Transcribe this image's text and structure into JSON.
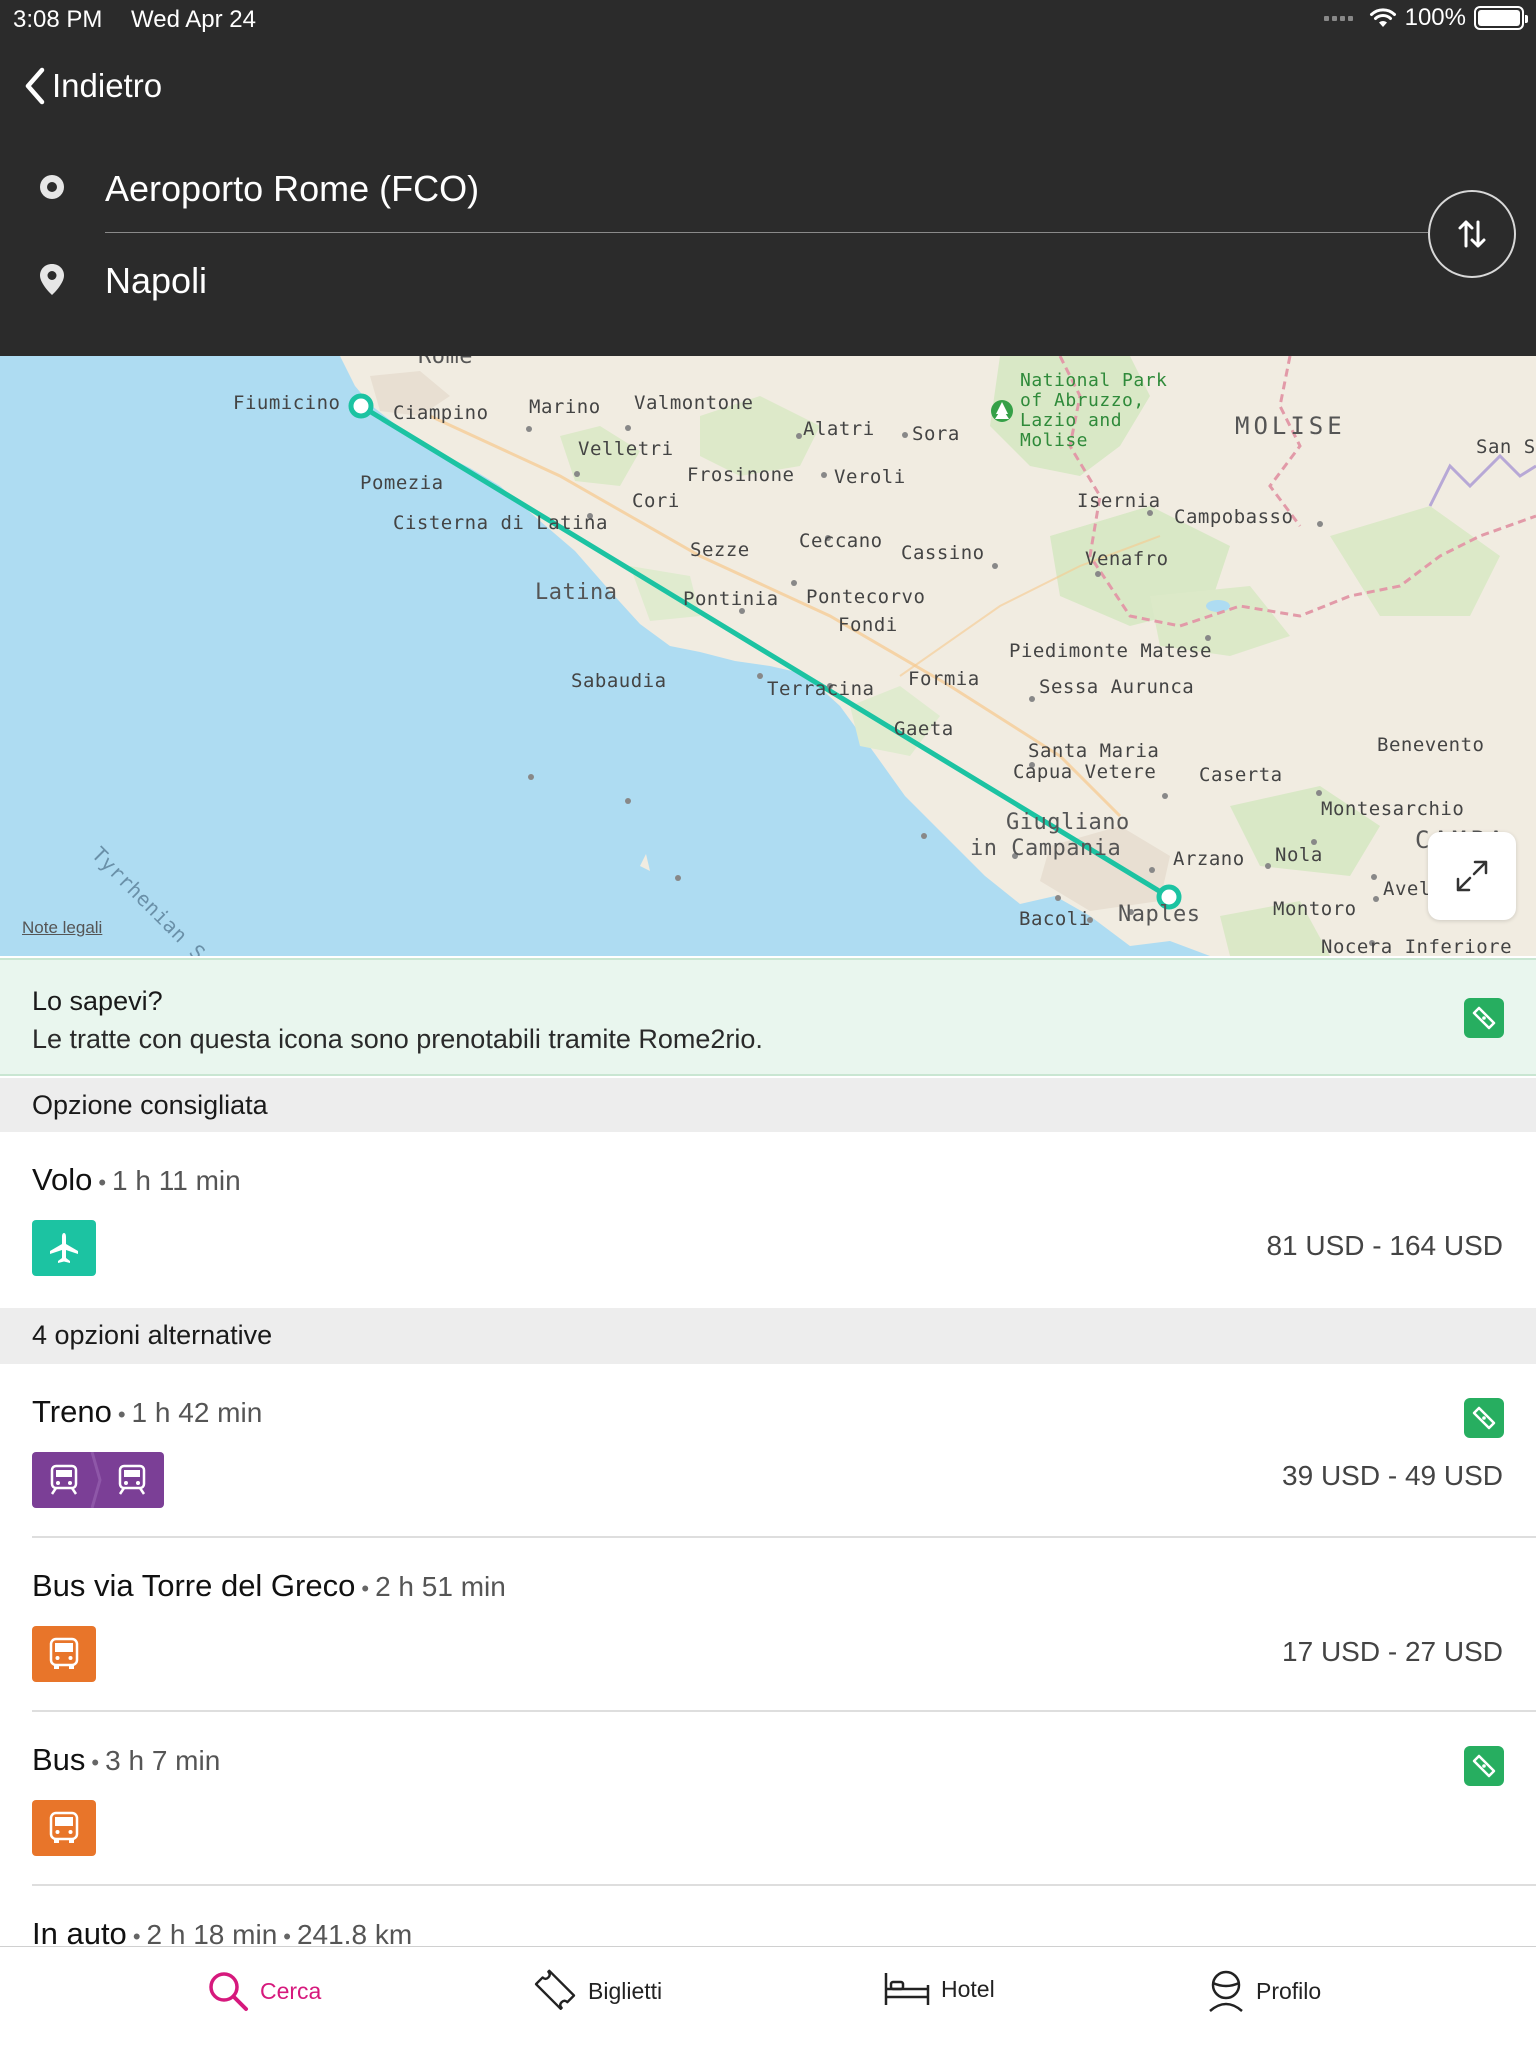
{
  "status_bar": {
    "time": "3:08 PM",
    "date": "Wed Apr 24",
    "battery": "100%"
  },
  "header": {
    "back_label": "Indietro",
    "from": "Aeroporto Rome (FCO)",
    "to": "Napoli"
  },
  "map": {
    "labels": {
      "rome": "Rome",
      "fiumicino": "Fiumicino",
      "ciampino": "Ciampino",
      "marino": "Marino",
      "valmontone": "Valmontone",
      "velletri": "Velletri",
      "alatri": "Alatri",
      "sora": "Sora",
      "park": "National Park\nof Abruzzo,\nLazio and\nMolise",
      "molise": "MOLISE",
      "san": "San S",
      "pomezia": "Pomezia",
      "frosinone": "Frosinone",
      "veroli": "Veroli",
      "cori": "Cori",
      "isernia": "Isernia",
      "campobasso": "Campobasso",
      "cisterna": "Cisterna di Latina",
      "sezze": "Sezze",
      "ceccano": "Ceccano",
      "cassino": "Cassino",
      "venafro": "Venafro",
      "latina": "Latina",
      "pontinia": "Pontinia",
      "pontecorvo": "Pontecorvo",
      "fondi": "Fondi",
      "piedimonte": "Piedimonte Matese",
      "sabaudia": "Sabaudia",
      "terracina": "Terracina",
      "formia": "Formia",
      "sessa": "Sessa Aurunca",
      "gaeta": "Gaeta",
      "santa_maria": "Santa Maria",
      "capua": "Capua Vetere",
      "caserta": "Caserta",
      "benevento": "Benevento",
      "montesarchio": "Montesarchio",
      "giugliano": "Giugliano",
      "in_campania": "in Campania",
      "arzano": "Arzano",
      "nola": "Nola",
      "campania": "CAMPA",
      "avel": "Avel",
      "bacoli": "Bacoli",
      "naples": "Naples",
      "montoro": "Montoro",
      "nocera": "Nocera Inferiore",
      "sea": "Tyrrhenian S"
    },
    "legal_link": "Note legali",
    "route_color": "#1cc3a2"
  },
  "info_banner": {
    "title": "Lo sapevi?",
    "text": "Le tratte con questa icona sono prenotabili tramite Rome2rio."
  },
  "recommended": {
    "header": "Opzione consigliata",
    "option": {
      "mode": "Volo",
      "duration": "1 h 11 min",
      "price": "81 USD - 164 USD",
      "icon": "plane-icon",
      "color": "#1cc3a2"
    }
  },
  "alternatives": {
    "header": "4 opzioni alternative",
    "options": [
      {
        "mode": "Treno",
        "duration": "1 h 42 min",
        "price": "39 USD - 49 USD",
        "bookable": true,
        "color": "#7b3f96"
      },
      {
        "mode": "Bus via Torre del Greco",
        "duration": "2 h 51 min",
        "price": "17 USD - 27 USD",
        "bookable": false,
        "color": "#e8752a"
      },
      {
        "mode": "Bus",
        "duration": "3 h 7 min",
        "price": "",
        "bookable": true,
        "color": "#e8752a"
      },
      {
        "mode": "In auto",
        "duration": "2 h 18 min",
        "distance": "241.8 km"
      }
    ]
  },
  "separator": "•",
  "tabbar": {
    "active_color": "#d6197d",
    "tabs": [
      {
        "label": "Cerca",
        "icon": "search-icon",
        "active": true
      },
      {
        "label": "Biglietti",
        "icon": "ticket-icon",
        "active": false
      },
      {
        "label": "Hotel",
        "icon": "bed-icon",
        "active": false
      },
      {
        "label": "Profilo",
        "icon": "profile-icon",
        "active": false
      }
    ]
  }
}
